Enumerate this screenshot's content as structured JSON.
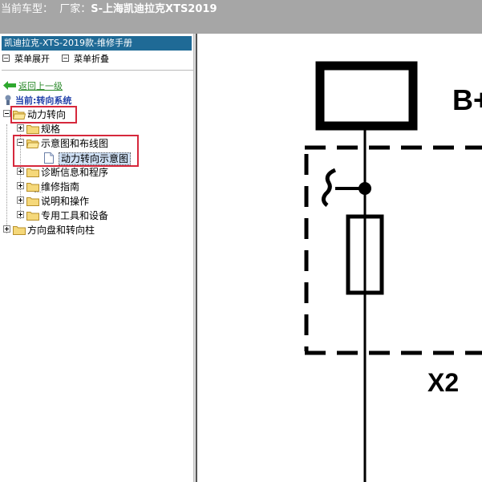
{
  "title": {
    "prefix": "当前车型：",
    "maker_label": "厂家：",
    "model": "S-上海凯迪拉克XTS2019"
  },
  "panel": {
    "header": "凯迪拉克-XTS-2019款-维修手册",
    "expand_all": "菜单展开",
    "collapse_all": "菜单折叠",
    "back": "返回上一级",
    "current": "当前:转向系统"
  },
  "tree": [
    {
      "label": "动力转向",
      "expanded": true
    },
    {
      "label": "规格",
      "expanded": false
    },
    {
      "label": "示意图和布线图",
      "expanded": true
    },
    {
      "label": "动力转向示意图",
      "selected": true
    },
    {
      "label": "诊断信息和程序",
      "expanded": false
    },
    {
      "label": "维修指南",
      "expanded": false
    },
    {
      "label": "说明和操作",
      "expanded": false
    },
    {
      "label": "专用工具和设备",
      "expanded": false
    },
    {
      "label": "方向盘和转向柱",
      "expanded": false
    }
  ],
  "diagram": {
    "label_top": "B+",
    "label_bottom": "X2"
  },
  "colors": {
    "titlebar": "#a6a6a6",
    "panel_header": "#1f6a96",
    "highlight_box": "#d6283c",
    "link_green": "#2c8a2c",
    "current_blue": "#1f3fa8"
  }
}
